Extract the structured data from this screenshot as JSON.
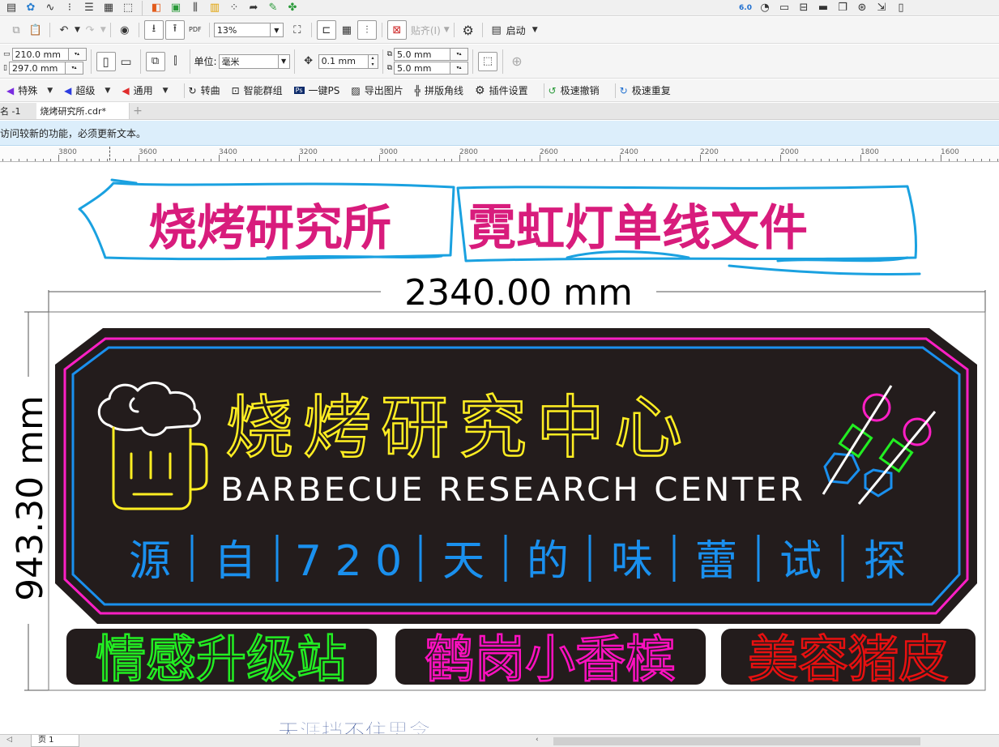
{
  "toolbar_std": {
    "zoom": "13%",
    "snap_label": "贴齐(I)",
    "launch_label": "启动",
    "pdf_label": "PDF",
    "version_badge": "6.0"
  },
  "prop_bar": {
    "width": "210.0 mm",
    "height": "297.0 mm",
    "units_label": "单位:",
    "units_value": "毫米",
    "nudge": "0.1 mm",
    "dup_x": "5.0 mm",
    "dup_y": "5.0 mm"
  },
  "plugin_bar": [
    {
      "label": "特殊",
      "icon": "feather-icon",
      "has_dropdown": true
    },
    {
      "label": "超级",
      "icon": "feather-icon",
      "has_dropdown": true
    },
    {
      "label": "通用",
      "icon": "feather-icon",
      "has_dropdown": true
    },
    {
      "label": "转曲",
      "icon": "curve-icon",
      "has_dropdown": false
    },
    {
      "label": "智能群组",
      "icon": "group-icon",
      "has_dropdown": false
    },
    {
      "label": "一键PS",
      "icon": "ps-icon",
      "has_dropdown": false
    },
    {
      "label": "导出图片",
      "icon": "image-icon",
      "has_dropdown": false
    },
    {
      "label": "拼版角线",
      "icon": "crop-mark-icon",
      "has_dropdown": false
    },
    {
      "label": "插件设置",
      "icon": "gear-icon",
      "has_dropdown": false
    },
    {
      "label": "极速撤销",
      "icon": "undo-icon",
      "has_dropdown": false
    },
    {
      "label": "极速重复",
      "icon": "redo-icon",
      "has_dropdown": false
    }
  ],
  "tabs": [
    {
      "label": "名 -1",
      "active": false
    },
    {
      "label": "烧烤研究所.cdr*",
      "active": true
    }
  ],
  "notice": "访问较新的功能，必须更新文本。",
  "ruler_labels": [
    "3800",
    "3600",
    "3400",
    "3200",
    "3000",
    "2800",
    "2600",
    "2400",
    "2200",
    "2000",
    "1800",
    "1600"
  ],
  "canvas": {
    "header_left": "烧烤研究所",
    "header_right": "霓虹灯单线文件",
    "dim_width": "2340.00 mm",
    "dim_height": "943.30 mm",
    "sign_title": "烧烤研究中心",
    "sign_subtitle": "BARBECUE RESEARCH CENTER",
    "slogan_chars": [
      "源",
      "自",
      "7 2 0",
      "天",
      "的",
      "味",
      "蕾",
      "试",
      "探"
    ],
    "boxes": [
      {
        "text": "情感升级站",
        "color": "#22ee22"
      },
      {
        "text": "鹤岗小香槟",
        "color": "#ff10c0"
      },
      {
        "text": "美容猪皮",
        "color": "#e81010"
      }
    ],
    "watermark": "天涯挡不住思念"
  },
  "colors": {
    "neon_yellow": "#ffee22",
    "neon_white": "#ffffff",
    "neon_blue": "#1a90ee",
    "neon_pink": "#ff1fc5",
    "neon_green": "#22ee22",
    "sign_bg": "#231c1c",
    "header_outline": "#1aa1e0",
    "header_text": "#d81c7c",
    "watermark_blue": "#1c3a8a"
  },
  "status": {
    "page_label": "页 1"
  }
}
